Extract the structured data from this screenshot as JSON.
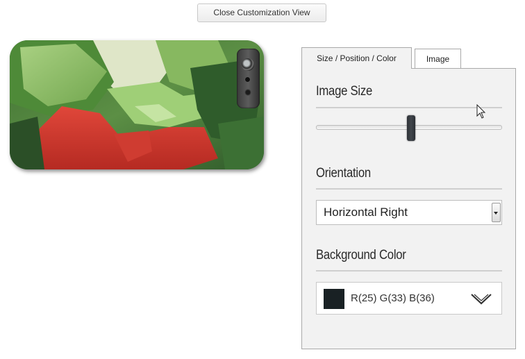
{
  "toolbar": {
    "close_label": "Close Customization View"
  },
  "tabs": [
    {
      "label": "Size / Position / Color",
      "active": true
    },
    {
      "label": "Image",
      "active": false
    }
  ],
  "panel": {
    "image_size": {
      "title": "Image Size",
      "slider_value_percent": 51
    },
    "orientation": {
      "title": "Orientation",
      "selected": "Horizontal Right"
    },
    "background_color": {
      "title": "Background Color",
      "value_label": "R(25) G(33) B(36)",
      "swatch_hex": "#192124"
    }
  },
  "icons": {
    "dropdown": "chevron-down-icon",
    "cursor": "mouse-pointer-icon"
  }
}
